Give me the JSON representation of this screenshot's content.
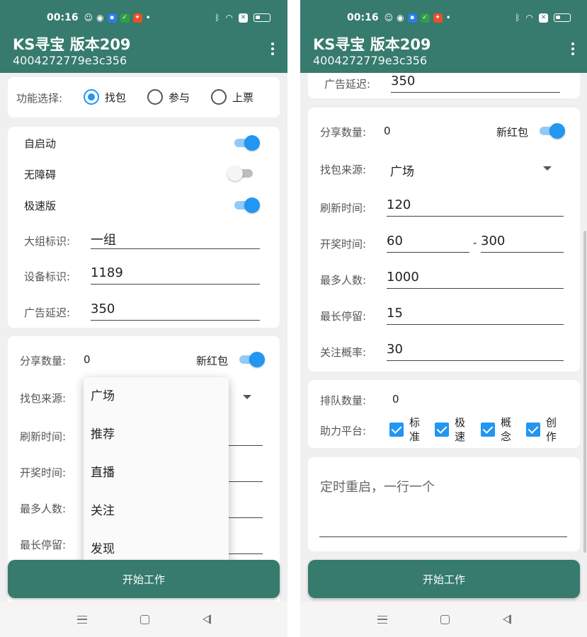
{
  "status_bar": {
    "time": "00:16"
  },
  "app": {
    "title": "KS寻宝 版本209",
    "subtitle": "4004272779e3c356"
  },
  "feature": {
    "label": "功能选择:",
    "options": [
      "找包",
      "参与",
      "上票"
    ],
    "selected": "找包"
  },
  "toggles": [
    {
      "label": "自启动",
      "on": true
    },
    {
      "label": "无障碍",
      "on": false
    },
    {
      "label": "极速版",
      "on": true
    }
  ],
  "fields": {
    "group_label": "大组标识:",
    "group_value": "一组",
    "device_label": "设备标识:",
    "device_value": "1189",
    "ad_delay_label": "广告延迟:",
    "ad_delay_value": "350"
  },
  "share": {
    "label": "分享数量:",
    "value": "0",
    "new_red_label": "新红包",
    "new_red_on": true
  },
  "source": {
    "label": "找包来源:",
    "value": "广场"
  },
  "refresh": {
    "label": "刷新时间:",
    "value": "120"
  },
  "lottery": {
    "label": "开奖时间:",
    "from": "60",
    "separator": "-",
    "to": "300"
  },
  "max_people": {
    "label": "最多人数:",
    "value": "1000"
  },
  "max_stay": {
    "label": "最长停留:",
    "value": "15"
  },
  "follow_rate": {
    "label": "关注概率:",
    "value": "30"
  },
  "queue": {
    "label": "排队数量:",
    "value": "0"
  },
  "platform": {
    "label": "助力平台:",
    "options": [
      {
        "label": "标准",
        "checked": true
      },
      {
        "label": "极速",
        "checked": true
      },
      {
        "label": "概念",
        "checked": true
      },
      {
        "label": "创作",
        "checked": true
      }
    ]
  },
  "restart_hint": "定时重启，一行一个",
  "dropdown_menu": [
    "广场",
    "推荐",
    "直播",
    "关注",
    "发现"
  ],
  "start_button": "开始工作",
  "colors": {
    "primary": "#367b6d",
    "accent": "#2196f3"
  }
}
